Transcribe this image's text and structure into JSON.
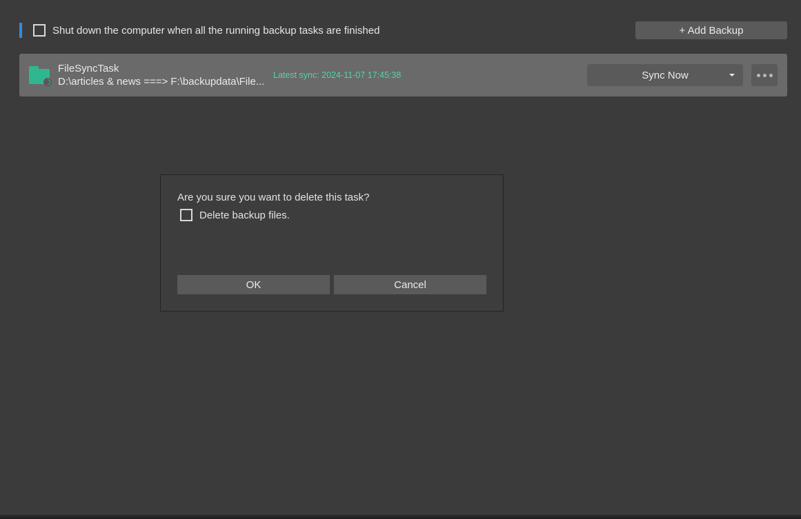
{
  "topbar": {
    "shutdown_label": "Shut down the computer when all the running backup tasks are finished",
    "add_backup_label": "+ Add Backup"
  },
  "task": {
    "name": "FileSyncTask",
    "path": "D:\\articles & news ===> F:\\backupdata\\File...",
    "latest_sync": "Latest sync: 2024-11-07 17:45:38",
    "sync_button_label": "Sync Now"
  },
  "dialog": {
    "message": "Are you sure you want to delete this task?",
    "delete_files_label": "Delete backup files.",
    "ok_label": "OK",
    "cancel_label": "Cancel"
  }
}
